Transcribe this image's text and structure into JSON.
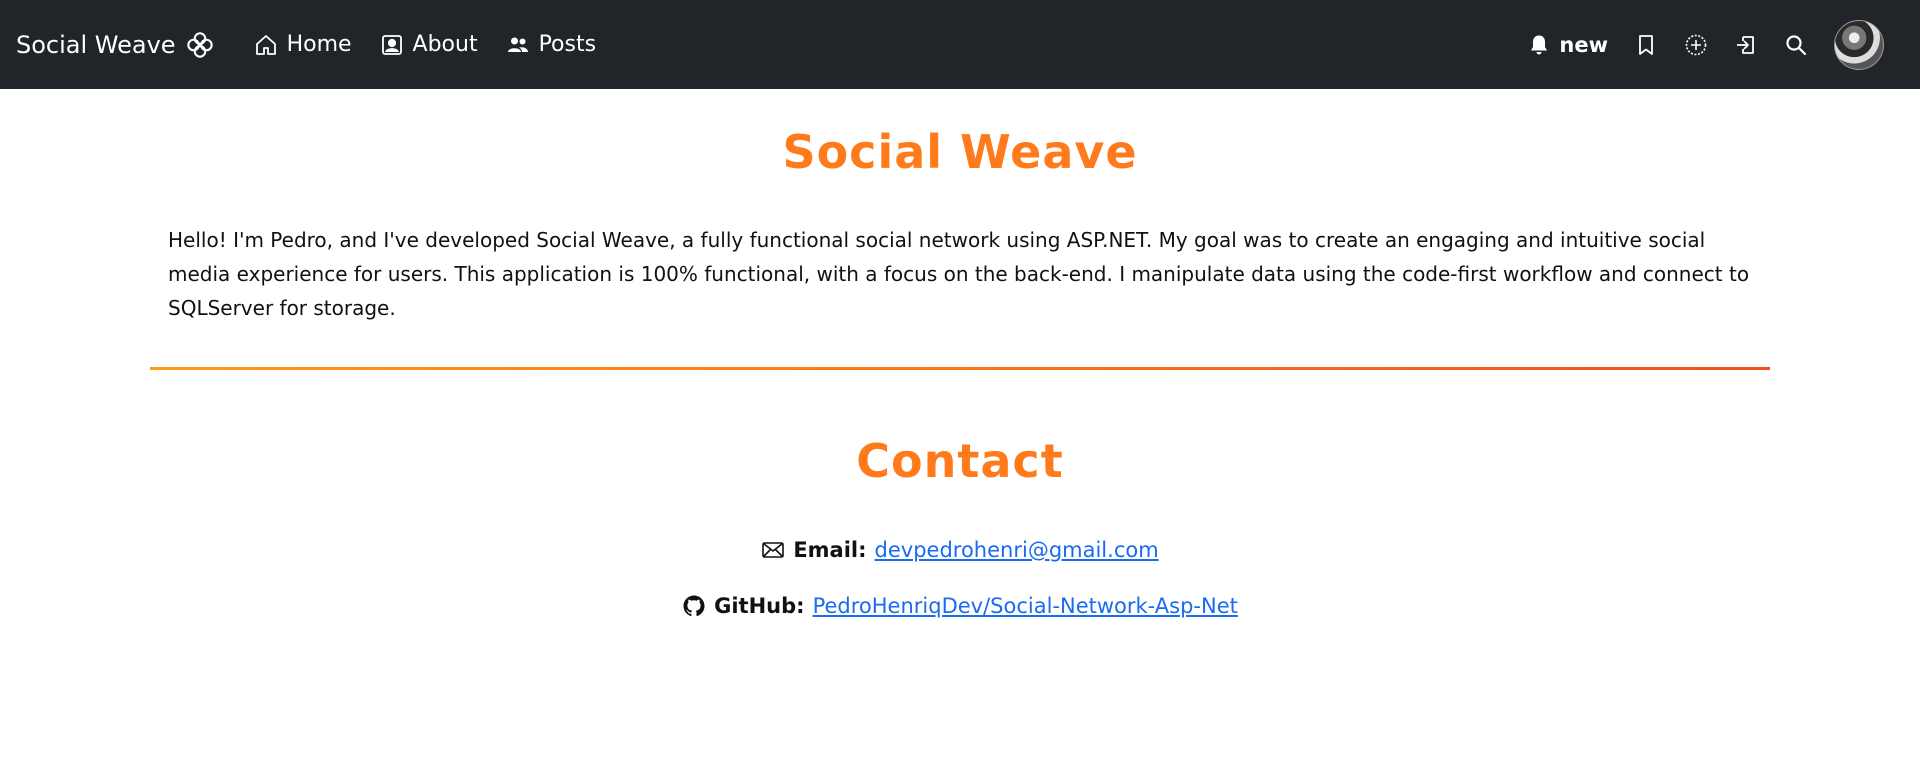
{
  "navbar": {
    "brand": "Social Weave",
    "links": [
      {
        "label": "Home",
        "icon": "house-icon"
      },
      {
        "label": "About",
        "icon": "person-badge-icon"
      },
      {
        "label": "Posts",
        "icon": "people-icon"
      }
    ],
    "notification_label": "new",
    "icons": [
      "bell-icon",
      "bookmark-icon",
      "plus-circle-icon",
      "logout-icon",
      "search-icon"
    ]
  },
  "main": {
    "title": "Social Weave",
    "intro": "Hello! I'm Pedro, and I've developed Social Weave, a fully functional social network using ASP.NET. My goal was to create an engaging and intuitive social media experience for users. This application is 100% functional, with a focus on the back-end. I manipulate data using the code-first workflow and connect to SQLServer for storage.",
    "contact_title": "Contact",
    "email_label": "Email:",
    "email_value": "devpedrohenri@gmail.com",
    "github_label": "GitHub:",
    "github_value": "PedroHenriqDev/Social-Network-Asp-Net"
  },
  "colors": {
    "navbar_bg": "#212529",
    "accent": "#ff7a1a",
    "link": "#1a6bf0"
  }
}
